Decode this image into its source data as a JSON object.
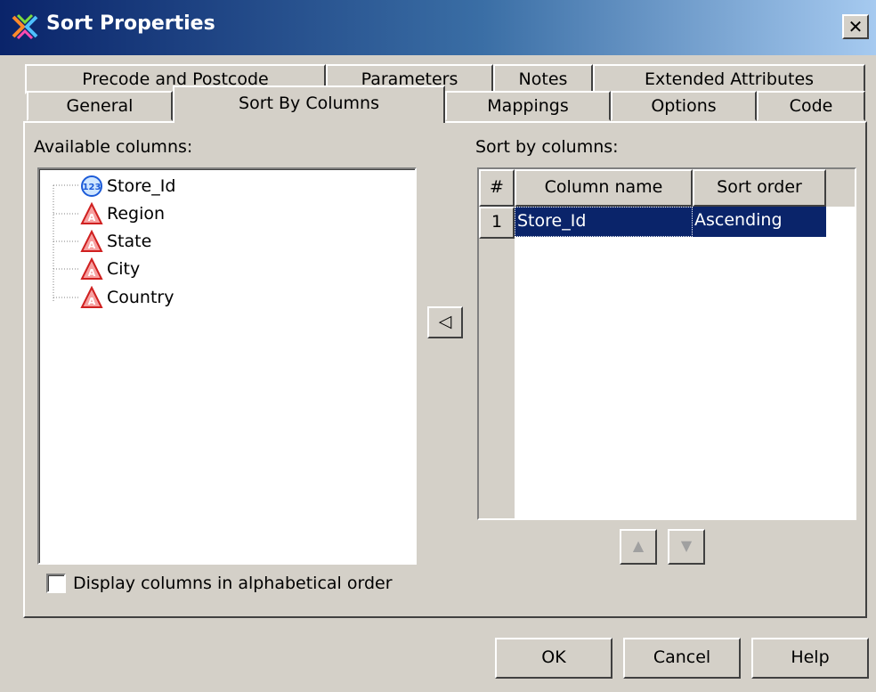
{
  "window": {
    "title": "Sort Properties",
    "close_glyph": "✕"
  },
  "tabs_row1": [
    {
      "label": "Precode and Postcode"
    },
    {
      "label": "Parameters"
    },
    {
      "label": "Notes"
    },
    {
      "label": "Extended Attributes"
    }
  ],
  "tabs_row2": [
    {
      "label": "General"
    },
    {
      "label": "Sort By Columns",
      "selected": true
    },
    {
      "label": "Mappings"
    },
    {
      "label": "Options"
    },
    {
      "label": "Code"
    }
  ],
  "available": {
    "label": "Available columns:",
    "items": [
      {
        "name": "Store_Id",
        "icon": "numeric-column-icon",
        "glyph": "123"
      },
      {
        "name": "Region",
        "icon": "character-column-icon",
        "glyph": "A"
      },
      {
        "name": "State",
        "icon": "character-column-icon",
        "glyph": "A"
      },
      {
        "name": "City",
        "icon": "character-column-icon",
        "glyph": "A"
      },
      {
        "name": "Country",
        "icon": "character-column-icon",
        "glyph": "A"
      }
    ],
    "alphabetical_checkbox": {
      "label": "Display columns in alphabetical order",
      "checked": false
    }
  },
  "move_button": {
    "glyph": "◁",
    "icon": "move-left-icon"
  },
  "sort_by": {
    "label": "Sort by columns:",
    "headers": {
      "num": "#",
      "column": "Column name",
      "order": "Sort order"
    },
    "rows": [
      {
        "num": "1",
        "column": "Store_Id",
        "order": "Ascending"
      }
    ],
    "up_glyph": "▲",
    "down_glyph": "▼"
  },
  "buttons": {
    "ok": "OK",
    "cancel": "Cancel",
    "help": "Help"
  },
  "colors": {
    "selection": "#0a246a",
    "titlebar_start": "#0a246a",
    "face": "#d4d0c8"
  }
}
